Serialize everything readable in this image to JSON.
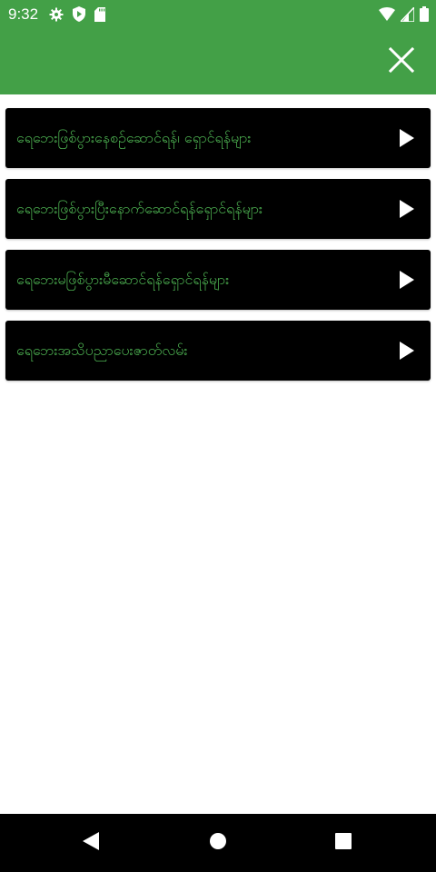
{
  "status_bar": {
    "time": "9:32",
    "left_icons": [
      "gear-icon",
      "shield-play-icon",
      "sd-card-icon"
    ],
    "right_icons": [
      "wifi-icon",
      "signal-icon",
      "battery-icon"
    ]
  },
  "app_bar": {
    "background": "#43A047",
    "close_icon": "close-icon"
  },
  "menu": {
    "text_color": "#4CAF50",
    "items": [
      {
        "label": "ရေဘေးဖြစ်ပွားနေစဉ်ဆောင်ရန်၊ ရှောင်ရန်များ",
        "icon": "play-icon"
      },
      {
        "label": "ရေဘေးဖြစ်ပွားပြီးနောက်ဆောင်ရန်ရှောင်ရန်များ",
        "icon": "play-icon"
      },
      {
        "label": "ရေဘေးမဖြစ်ပွားမီဆောင်ရန်ရှောင်ရန်များ",
        "icon": "play-icon"
      },
      {
        "label": "ရေဘေးအသိပညာပေးဇာတ်လမ်း",
        "icon": "play-icon"
      }
    ]
  },
  "nav_bar": {
    "buttons": [
      "back-icon",
      "home-icon",
      "recents-icon"
    ]
  }
}
